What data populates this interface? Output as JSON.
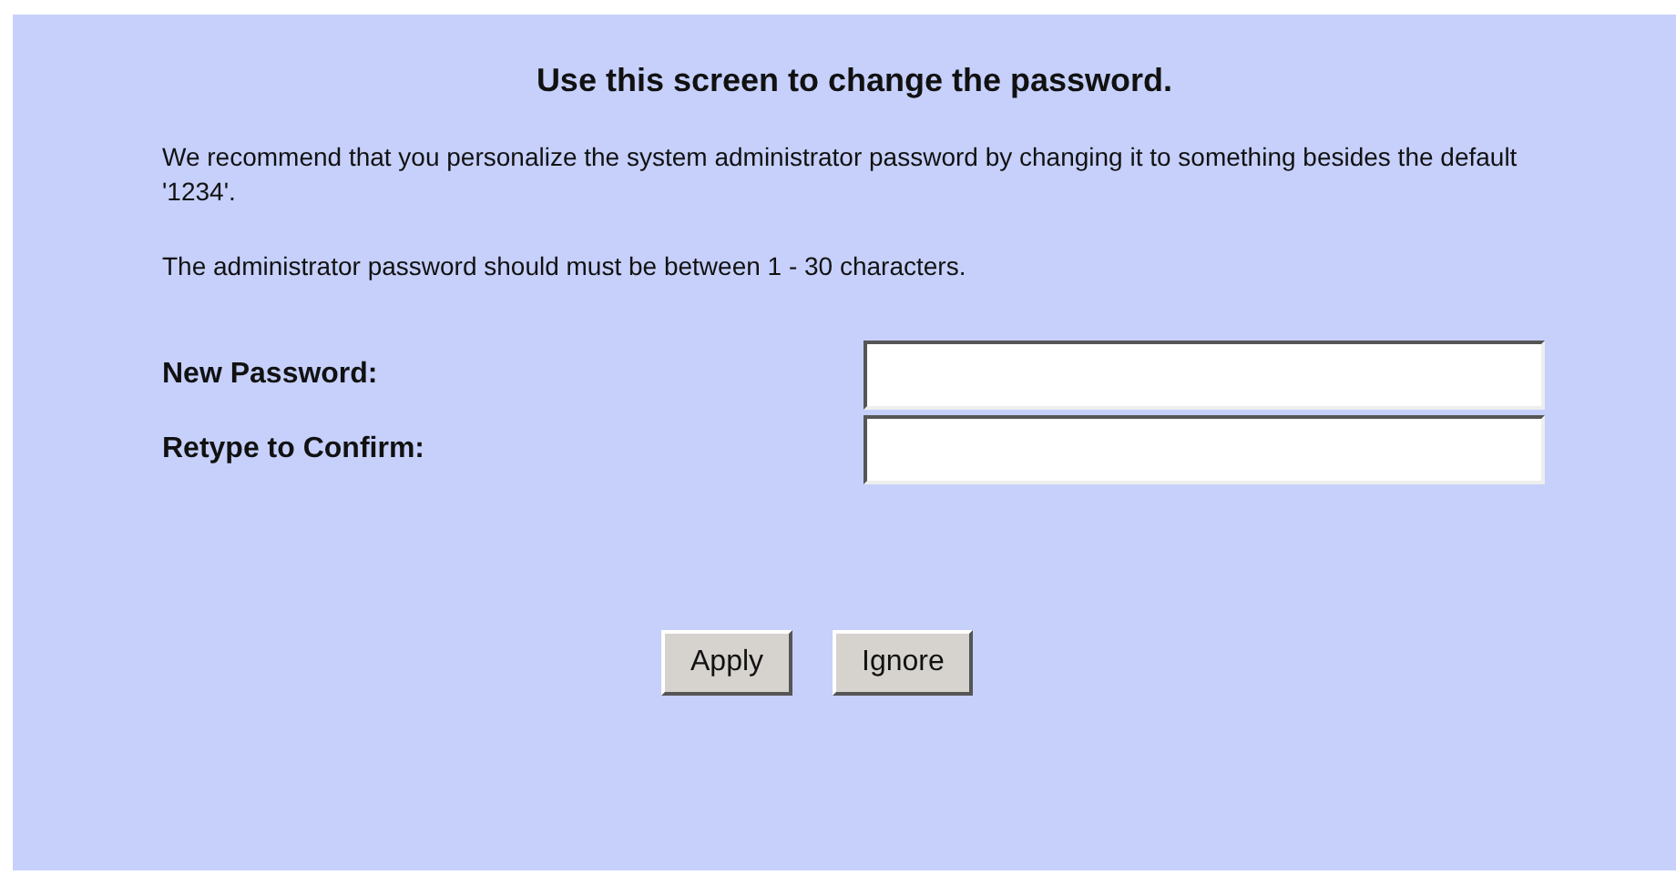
{
  "title": "Use this screen to change the password.",
  "paragraphs": [
    "We recommend that you personalize the system administrator password by changing it to something besides the default '1234'.",
    "The administrator password should must be between 1 - 30 characters."
  ],
  "fields": [
    {
      "label": "New Password:"
    },
    {
      "label": "Retype to Confirm:"
    }
  ],
  "buttons": [
    "Apply",
    "Ignore"
  ]
}
